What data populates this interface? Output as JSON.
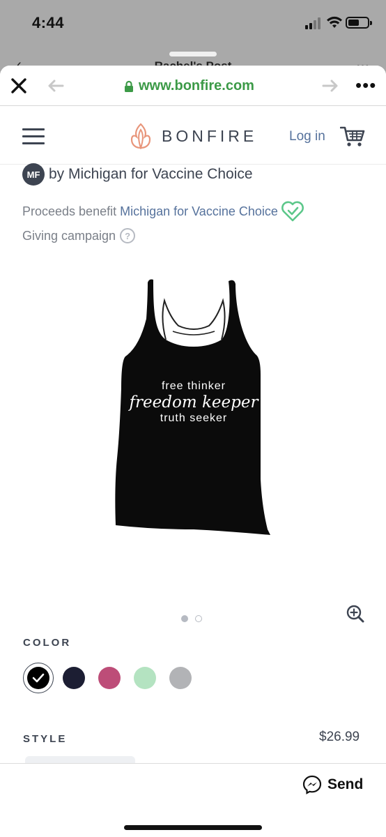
{
  "status_bar": {
    "time": "4:44"
  },
  "background_sheet": {
    "title": "Rachel's Post"
  },
  "browser": {
    "url": "www.bonfire.com",
    "more_label": "•••"
  },
  "header": {
    "logo_text": "BONFIRE",
    "login_label": "Log in"
  },
  "campaign": {
    "badge": "MF",
    "by_line": "by Michigan for Vaccine Choice",
    "proceeds_label": "Proceeds benefit",
    "proceeds_org": "Michigan for Vaccine Choice",
    "giving_label": "Giving campaign",
    "help_glyph": "?"
  },
  "product": {
    "print_line1": "free thinker",
    "print_line2": "freedom keeper",
    "print_line3": "truth seeker",
    "garment_color": "#0b0b0b"
  },
  "carousel": {
    "count": 2,
    "active_index": 0
  },
  "color": {
    "label": "COLOR",
    "swatches": [
      {
        "name": "Black",
        "hex": "#000000",
        "selected": true
      },
      {
        "name": "Navy",
        "hex": "#1c1e33",
        "selected": false
      },
      {
        "name": "Raspberry",
        "hex": "#bd4d78",
        "selected": false
      },
      {
        "name": "Mint",
        "hex": "#b4e3c1",
        "selected": false
      },
      {
        "name": "Gray",
        "hex": "#b2b3b6",
        "selected": false
      }
    ]
  },
  "style": {
    "label": "STYLE",
    "price": "$26.99"
  },
  "bottom": {
    "send_label": "Send"
  },
  "colors": {
    "accent_green": "#3c9a47",
    "link_blue": "#56729c",
    "heart_green": "#5cc78a",
    "logo_orange": "#e8957a"
  }
}
